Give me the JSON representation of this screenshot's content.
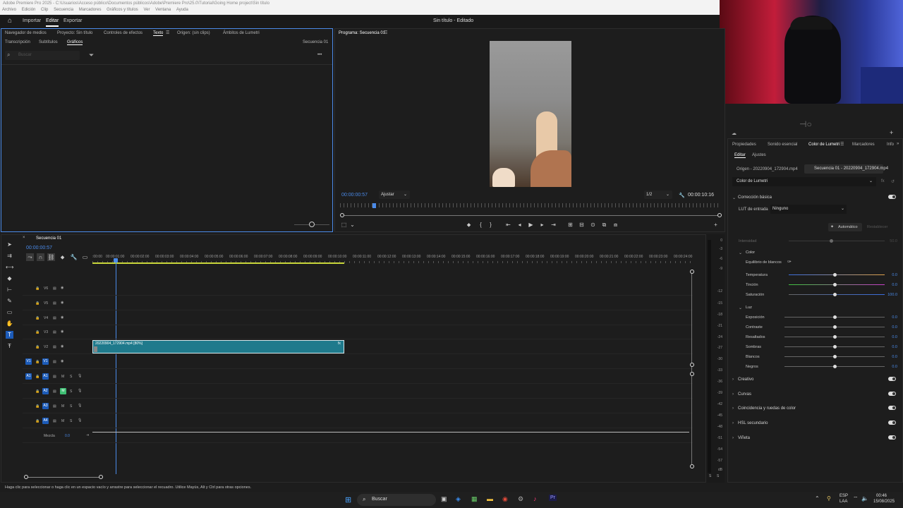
{
  "titlebar": {
    "text": "Adobe Premiere Pro 2025 - C:\\Usuarios\\Acceso público\\Documentos públicos\\Adobe\\Premiere Pro\\25.0\\Tutorial\\Going Home project\\Sin título"
  },
  "menu": [
    "Archivo",
    "Edición",
    "Clip",
    "Secuencia",
    "Marcadores",
    "Gráficos y títulos",
    "Ver",
    "Ventana",
    "Ayuda"
  ],
  "header": {
    "home_icon": "home-icon",
    "importar": "Importar",
    "editar": "Editar",
    "exportar": "Exportar",
    "doc_title": "Sin título - Editado"
  },
  "left_panel": {
    "tabs": [
      "Navegador de medios",
      "Proyecto: Sin título",
      "Controles de efectos",
      "Texto",
      "Origen: (sin clips)",
      "Ámbitos de Lumetri"
    ],
    "subtabs": [
      "Transcripción",
      "Subtítulos",
      "Gráficos"
    ],
    "sequence_label": "Secuencia 01",
    "search_placeholder": "Buscar",
    "more": "•••"
  },
  "program": {
    "title": "Programa: Secuencia 01",
    "timecode": "00:00:00:57",
    "fit": "Ajustar",
    "resolution": "1/2",
    "duration": "00:00:10:16"
  },
  "timeline": {
    "title": "Secuencia 01",
    "timecode": "00:00:00:57",
    "ruler": [
      ":00:00",
      "00:00:01:00",
      "00:00:02:00",
      "00:00:03:00",
      "00:00:04:00",
      "00:00:05:00",
      "00:00:06:00",
      "00:00:07:00",
      "00:00:08:00",
      "00:00:09:00",
      "00:00:10:00",
      "00:00:11:00",
      "00:00:12:00",
      "00:00:13:00",
      "00:00:14:00",
      "00:00:15:00",
      "00:00:16:00",
      "00:00:17:00",
      "00:00:18:00",
      "00:00:19:00",
      "00:00:20:00",
      "00:00:21:00",
      "00:00:22:00",
      "00:00:23:00",
      "00:00:24:00"
    ],
    "video_tracks": [
      "V6",
      "V5",
      "V4",
      "V3",
      "V2",
      "V1"
    ],
    "audio_tracks": [
      "A1",
      "A2",
      "A3",
      "A4"
    ],
    "src_v": "V1",
    "src_a": "A1",
    "mix_label": "Mezcla",
    "mix_value": "0.0",
    "clip_name": "20220904_172904.mp4 [80%]",
    "fx": "fx",
    "m": "M",
    "s": "S"
  },
  "meter": {
    "labels": [
      "0",
      "-3",
      "-6",
      "-9",
      "-12",
      "-15",
      "-18",
      "-21",
      "-24",
      "-27",
      "-30",
      "-33",
      "-36",
      "-39",
      "-42",
      "-45",
      "-48",
      "-51",
      "-54",
      "-57",
      "dB"
    ],
    "s": "S",
    "s2": "S"
  },
  "right_panel": {
    "tabs": [
      "Propiedades",
      "Sonido esencial",
      "Color de Lumetri",
      "Marcadores",
      "Info"
    ],
    "subtabs": [
      "Editar",
      "Ajustes"
    ],
    "source_tab": "Origen - 20220904_172904.mp4",
    "seq_tab": "Secuencia 01 - 20220904_172904.mp4",
    "effect": "Color de Lumetri",
    "basic": "Corrección básica",
    "lut_label": "LUT de entrada",
    "lut_value": "Ninguno",
    "auto": "Automático",
    "reset": "Restablecer",
    "intensity": "Intensidad",
    "intensity_val": "50.0",
    "color_header": "Color",
    "wb": "Equilibrio de blancos",
    "color_rows": [
      {
        "label": "Temperatura",
        "value": "0.0"
      },
      {
        "label": "Tinción",
        "value": "0.0"
      },
      {
        "label": "Saturación",
        "value": "100.0"
      }
    ],
    "light_header": "Luz",
    "light_rows": [
      {
        "label": "Exposición",
        "value": "0.0"
      },
      {
        "label": "Contraste",
        "value": "0.0"
      },
      {
        "label": "Resaltados",
        "value": "0.0"
      },
      {
        "label": "Sombras",
        "value": "0.0"
      },
      {
        "label": "Blancos",
        "value": "0.0"
      },
      {
        "label": "Negros",
        "value": "0.0"
      }
    ],
    "sections": [
      "Creativo",
      "Curvas",
      "Coincidencia y ruedas de color",
      "HSL secundario",
      "Viñeta"
    ]
  },
  "status_text": "Haga clic para seleccionar o haga clic en un espacio vacío y arrastre para seleccionar el recuadro. Utilice Mayús, Alt y Ctrl para otras opciones.",
  "taskbar": {
    "search": "Buscar",
    "lang1": "ESP",
    "lang2": "LAA",
    "time": "00:46",
    "date": "15/08/2025"
  },
  "colors": {
    "accent": "#4a8ae8",
    "clip": "#1f7a8c",
    "track_btn": "#1c5bb8",
    "playhead": "#4a8ae8"
  }
}
